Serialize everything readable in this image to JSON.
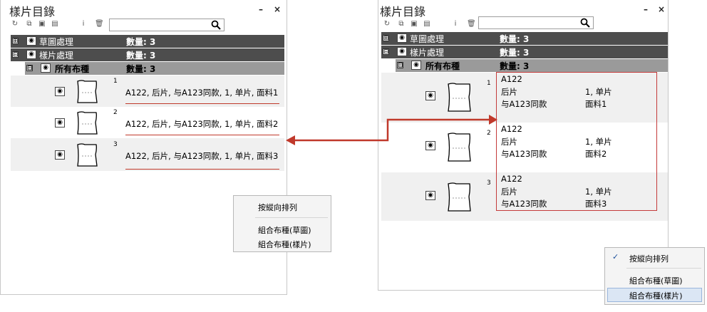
{
  "left": {
    "title": "樣片目錄",
    "minimize": "–",
    "close": "×",
    "rows": [
      {
        "toggle": "⊞",
        "label": "草圖處理",
        "count": "數量: 3"
      },
      {
        "toggle": "⊟",
        "label": "樣片處理",
        "count": "數量: 3"
      }
    ],
    "subrow": {
      "toggle": "⊟",
      "label": "所有布種",
      "count": "數量: 3"
    },
    "items": [
      {
        "num": "1",
        "text": "A122, 后片, 与A123同款, 1, 单片, 面料1"
      },
      {
        "num": "2",
        "text": "A122, 后片, 与A123同款, 1, 单片, 面料2"
      },
      {
        "num": "3",
        "text": "A122, 后片, 与A123同款, 1, 单片, 面料3"
      }
    ],
    "menu": {
      "item1": "按縱向排列",
      "item2": "組合布種(草圖)",
      "item3": "組合布種(樣片)"
    }
  },
  "right": {
    "title": "樣片目錄",
    "minimize": "–",
    "close": "×",
    "rows": [
      {
        "toggle": "⊞",
        "label": "草圖處理",
        "count": "數量: 3"
      },
      {
        "toggle": "⊟",
        "label": "樣片處理",
        "count": "數量: 3"
      }
    ],
    "subrow": {
      "toggle": "⊟",
      "label": "所有布種",
      "count": "數量: 3"
    },
    "items": [
      {
        "num": "1",
        "code": "A122",
        "part": "后片",
        "qty": "1, 单片",
        "note": "与A123同款",
        "fabric": "面料1"
      },
      {
        "num": "2",
        "code": "A122",
        "part": "后片",
        "qty": "1, 单片",
        "note": "与A123同款",
        "fabric": "面料2"
      },
      {
        "num": "3",
        "code": "A122",
        "part": "后片",
        "qty": "1, 单片",
        "note": "与A123同款",
        "fabric": "面料3"
      }
    ],
    "menu": {
      "check": "✓",
      "item1": "按縱向排列",
      "item2": "組合布種(草圖)",
      "item3": "組合布種(樣片)"
    }
  },
  "icons": {
    "eye": "👁",
    "search": "🔍"
  },
  "colors": {
    "dark_row": "#4d4d4d",
    "mid_row": "#9a9a9a",
    "accent_red": "#c0392b",
    "arrow": "#c0392b"
  }
}
